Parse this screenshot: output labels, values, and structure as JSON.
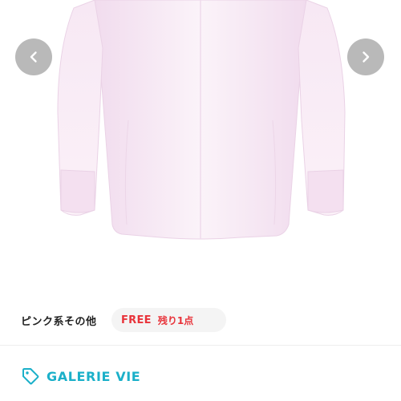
{
  "gallery": {
    "image_subject": "pink long-sleeve shirt",
    "prev_icon": "chevron-left-icon",
    "next_icon": "chevron-right-icon"
  },
  "variant": {
    "color": "ピンク系その他",
    "size": "FREE",
    "stock": "残り1点"
  },
  "brand": {
    "icon": "tag-icon",
    "name": "GALERIE VIE"
  },
  "colors": {
    "accent_red": "#e8333a",
    "brand_teal": "#1bb0c9",
    "nav_button": "#b9b9b9"
  }
}
